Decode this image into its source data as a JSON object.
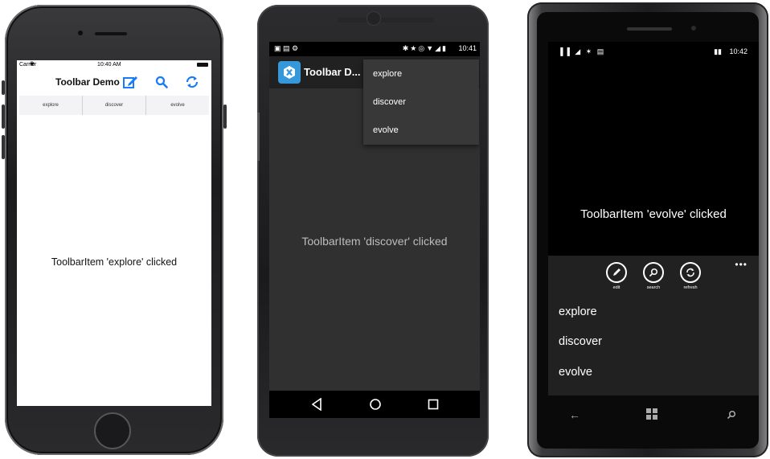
{
  "ios": {
    "carrier": "Carrier",
    "time": "10:40 AM",
    "title": "Toolbar Demo",
    "segments": [
      "explore",
      "discover",
      "evolve"
    ],
    "message": "ToolbarItem 'explore' clicked",
    "accent": "#1a7cf5"
  },
  "android": {
    "time": "10:41",
    "title": "Toolbar D...",
    "menu": [
      "explore",
      "discover",
      "evolve"
    ],
    "message": "ToolbarItem 'discover' clicked",
    "accent": "#3498db"
  },
  "winphone": {
    "time": "10:42",
    "message": "ToolbarItem 'evolve' clicked",
    "buttons": [
      {
        "label": "edit",
        "icon": "edit-icon"
      },
      {
        "label": "search",
        "icon": "search-icon"
      },
      {
        "label": "refresh",
        "icon": "refresh-icon"
      }
    ],
    "more": "•••",
    "menu": [
      "explore",
      "discover",
      "evolve"
    ]
  }
}
